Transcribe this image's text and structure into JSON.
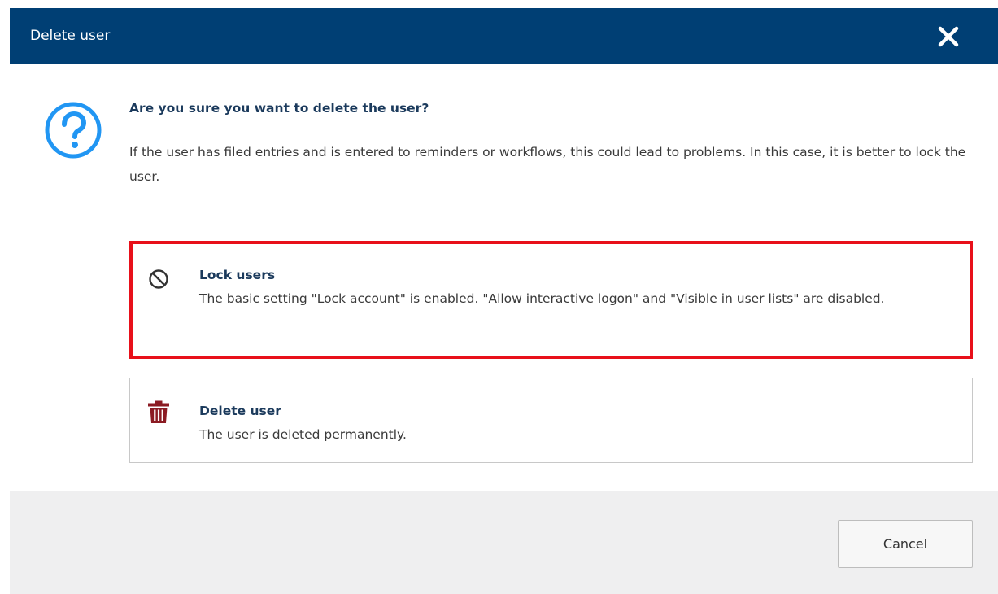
{
  "dialog": {
    "title": "Delete user",
    "close_icon": "close-icon"
  },
  "prompt": {
    "icon": "question-circle-icon",
    "heading": "Are you sure you want to delete the user?",
    "body": "If the user has filed entries and is entered to reminders or workflows, this could lead to problems. In this case, it is better to lock the user."
  },
  "options": [
    {
      "icon": "prohibited-icon",
      "title": "Lock users",
      "description": "The basic setting \"Lock account\" is enabled. \"Allow interactive logon\" and \"Visible in user lists\" are disabled.",
      "selected": true
    },
    {
      "icon": "trash-icon",
      "title": "Delete user",
      "description": "The user is deleted permanently.",
      "selected": false
    }
  ],
  "footer": {
    "cancel_label": "Cancel"
  },
  "colors": {
    "titlebar": "#003f74",
    "question_icon": "#2196f3",
    "trash_icon": "#8b1a22",
    "selected_border": "#e8101a",
    "footer_bg": "#efeff0"
  }
}
